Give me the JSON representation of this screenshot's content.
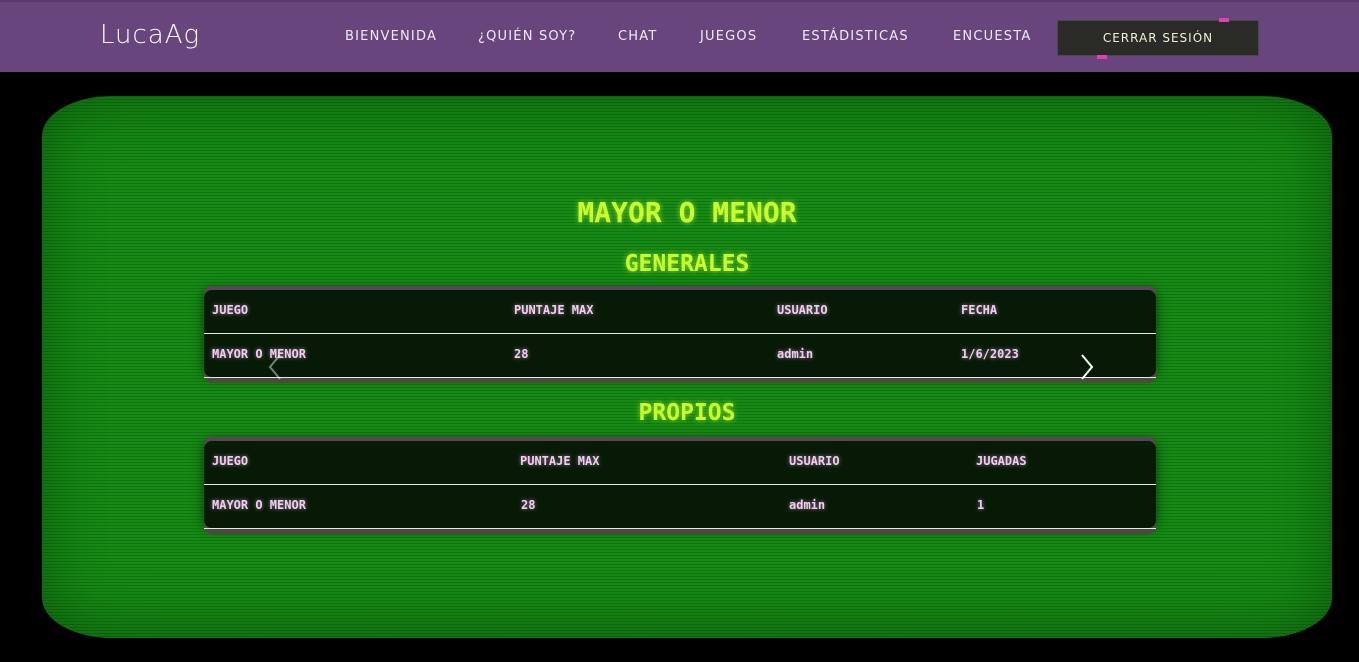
{
  "navbar": {
    "brand": "LucaAg",
    "links": [
      "BIENVENIDA",
      "¿QUIÉN SOY?",
      "CHAT",
      "JUEGOS",
      "ESTÁDISTICAS",
      "ENCUESTA"
    ],
    "logout_label": "CERRAR SESIÓN"
  },
  "main": {
    "title": "MAYOR O MENOR",
    "generales": {
      "heading": "GENERALES",
      "columns": [
        "JUEGO",
        "PUNTAJE MAX",
        "USUARIO",
        "FECHA"
      ],
      "row": [
        "MAYOR O MENOR",
        "28",
        "admin",
        "1/6/2023"
      ]
    },
    "propios": {
      "heading": "PROPIOS",
      "columns": [
        "JUEGO",
        "PUNTAJE MAX",
        "USUARIO",
        "JUGADAS"
      ],
      "row": [
        "MAYOR O MENOR",
        "28",
        "admin",
        "1"
      ]
    }
  },
  "icons": {
    "prev": "chevron-left-icon",
    "next": "chevron-right-icon"
  },
  "colors": {
    "navbar_bg": "#68457c",
    "screen_green": "#158a14",
    "title_glow": "#c8ff2e",
    "table_text": "#f6c9f4",
    "accent_pink": "#e23fb5"
  }
}
